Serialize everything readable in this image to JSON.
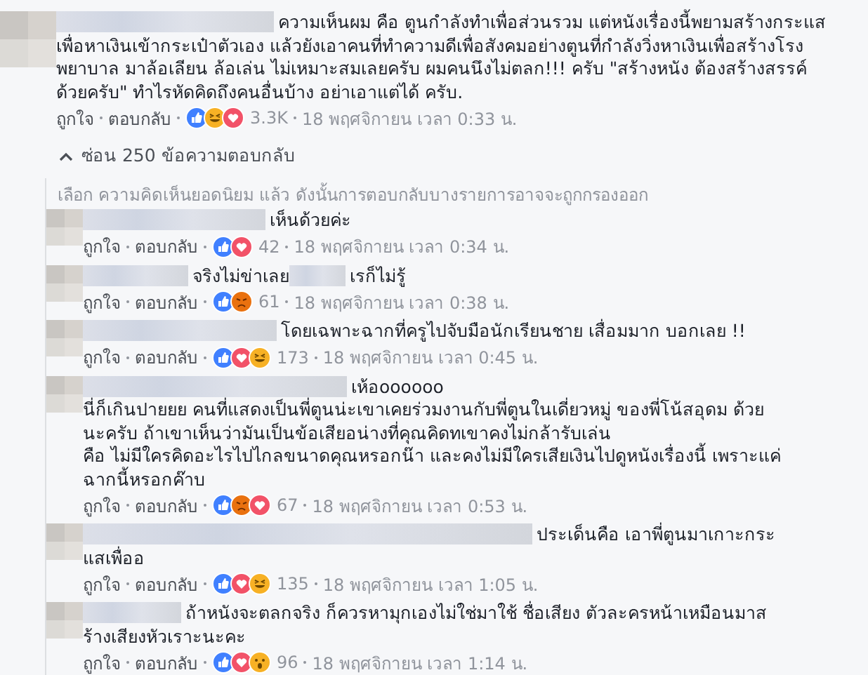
{
  "comment": {
    "body": [
      {
        "kind": "redacted"
      },
      {
        "kind": "text",
        "text": "ความเห็นผม คือ ตูนกำลังทำเพื่อส่วนรวม แต่หนังเรื่องนี้พยามสร้างกระแสเพื่อหาเงินเข้ากระเป๋าตัวเอง แล้วยังเอาคนที่ทำความดีเพื่อสังคมอย่างตูนที่กำลังวิ่งหาเงินเพื่อสร้างโรงพยาบาล มาล้อเลียน ล้อเล่น ไม่เหมาะสมเลยครับ ผมคนนึงไม่ตลก!!! ครับ \"สร้างหนัง ต้องสร้างสรรค์ด้วยครับ\" ทำไรหัดคิดถึงคนอื่นบ้าง อย่าเอาแต่ได้ ครับ."
      }
    ],
    "like": "ถูกใจ",
    "reply": "ตอบกลับ",
    "reactions": [
      {
        "kind": "like"
      },
      {
        "kind": "haha"
      },
      {
        "kind": "love"
      }
    ],
    "count": "3.3K",
    "time": "18 พฤศจิกายน เวลา 0:33 น."
  },
  "hide_replies": "ซ่อน 250 ข้อความตอบกลับ",
  "filter_notice": "เลือก ความคิดเห็นยอดนิยม แล้ว ดังนั้นการตอบกลับบางรายการอาจจะถูกกรองออก",
  "replies": [
    {
      "body": [
        {
          "kind": "redacted"
        },
        {
          "kind": "text",
          "text": "เห็นด้วยค่ะ"
        }
      ],
      "like": "ถูกใจ",
      "reply": "ตอบกลับ",
      "reactions": [
        {
          "kind": "like"
        },
        {
          "kind": "love"
        }
      ],
      "count": "42",
      "time": "18 พฤศจิกายน เวลา 0:34 น."
    },
    {
      "body": [
        {
          "kind": "redacted"
        },
        {
          "kind": "text",
          "text": "จริงไม่ข่าเลย"
        },
        {
          "kind": "redacted"
        },
        {
          "kind": "text",
          "text": "เรก็ไม่รู้"
        }
      ],
      "like": "ถูกใจ",
      "reply": "ตอบกลับ",
      "reactions": [
        {
          "kind": "like"
        },
        {
          "kind": "angry"
        }
      ],
      "count": "61",
      "time": "18 พฤศจิกายน เวลา 0:38 น."
    },
    {
      "body": [
        {
          "kind": "redacted"
        },
        {
          "kind": "text",
          "text": "โดยเฉพาะฉากที่ครูไปจับมือนักเรียนชาย เสื่อมมาก บอกเลย !!"
        }
      ],
      "like": "ถูกใจ",
      "reply": "ตอบกลับ",
      "reactions": [
        {
          "kind": "like"
        },
        {
          "kind": "love"
        },
        {
          "kind": "haha"
        }
      ],
      "count": "173",
      "time": "18 พฤศจิกายน เวลา 0:45 น."
    },
    {
      "body": [
        {
          "kind": "redacted"
        },
        {
          "kind": "text",
          "text": "เห้อoooooo"
        },
        {
          "kind": "break"
        },
        {
          "kind": "text",
          "text": "นี่ก็เกินปายยย คนที่แสดงเป็นพี่ตูนน่ะเขาเคยร่วมงานกับพี่ตูนในเดี่ยวหมู่ ของพี่โน้สอุดม ด้วยนะครับ ถ้าเขาเห็นว่ามันเป็นข้อเสียอน่างที่คุณคิดทเขาคงไม่กล้ารับเล่น"
        },
        {
          "kind": "break"
        },
        {
          "kind": "text",
          "text": "คือ ไม่มีใครคิดอะไรไปไกลขนาดคุณหรอกน๊า และคงไม่มีใครเสียเงินไปดูหนังเรื่องนี้ เพราะแค่ฉากนี้หรอกค๊าบ"
        }
      ],
      "like": "ถูกใจ",
      "reply": "ตอบกลับ",
      "reactions": [
        {
          "kind": "like"
        },
        {
          "kind": "angry"
        },
        {
          "kind": "love"
        }
      ],
      "count": "67",
      "time": "18 พฤศจิกายน เวลา 0:53 น."
    },
    {
      "body": [
        {
          "kind": "redacted"
        },
        {
          "kind": "text",
          "text": "ประเด็นคือ เอาพี่ตูนมาเกาะกระแสเพื่ออ"
        }
      ],
      "like": "ถูกใจ",
      "reply": "ตอบกลับ",
      "reactions": [
        {
          "kind": "like"
        },
        {
          "kind": "love"
        },
        {
          "kind": "haha"
        }
      ],
      "count": "135",
      "time": "18 พฤศจิกายน เวลา 1:05 น."
    },
    {
      "body": [
        {
          "kind": "redacted"
        },
        {
          "kind": "text",
          "text": "ถ้าหนังจะตลกจริง ก็ควรหามุกเองไม่ใช่มาใช้ ชื่อเสียง ตัวละครหน้าเหมือนมาสร้างเสียงหัวเราะนะคะ"
        }
      ],
      "like": "ถูกใจ",
      "reply": "ตอบกลับ",
      "reactions": [
        {
          "kind": "like"
        },
        {
          "kind": "love"
        },
        {
          "kind": "wow"
        }
      ],
      "count": "96",
      "time": "18 พฤศจิกายน เวลา 1:14 น."
    }
  ]
}
